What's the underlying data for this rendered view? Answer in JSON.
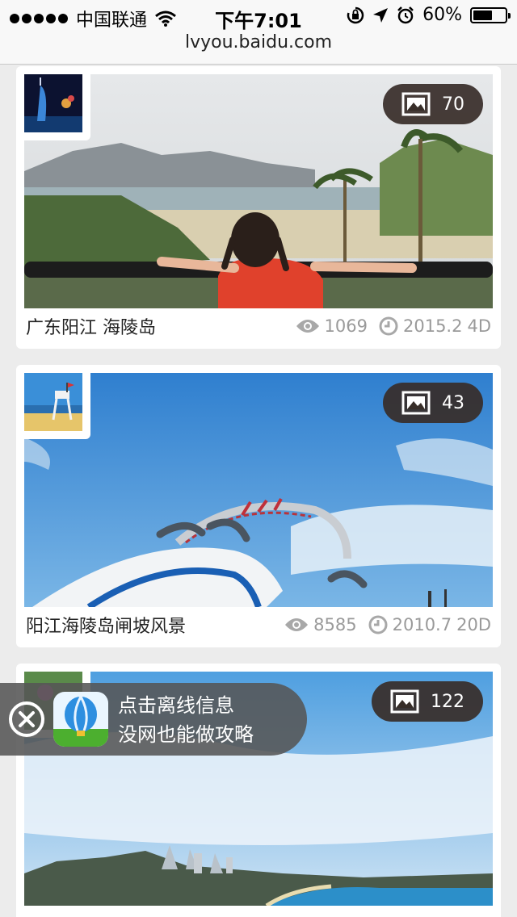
{
  "status_bar": {
    "carrier": "中国联通",
    "time": "下午7:01",
    "battery_percent": "60%",
    "battery_level": 0.6,
    "icons": [
      "signal-dots-icon",
      "wifi-icon",
      "rotation-lock-icon",
      "location-arrow-icon",
      "alarm-icon",
      "battery-icon"
    ]
  },
  "browser": {
    "url": "lvyou.baidu.com"
  },
  "cards": [
    {
      "photo_count": "70",
      "title": "广东阳江 海陵岛",
      "views": "1069",
      "date": "2015.2",
      "duration": "4D"
    },
    {
      "photo_count": "43",
      "title": "阳江海陵岛闸坡风景",
      "views": "8585",
      "date": "2010.7",
      "duration": "20D"
    },
    {
      "photo_count": "122",
      "title": "",
      "views": "",
      "date": "",
      "duration": ""
    }
  ],
  "promo": {
    "line1": "点击离线信息",
    "line2": "没网也能做攻略"
  },
  "icons": {
    "badge": "picture-icon",
    "views": "eye-icon",
    "date": "clock-icon",
    "close": "close-icon",
    "app": "hot-air-balloon-icon"
  },
  "colors": {
    "badge_bg": "#372d28",
    "meta_text": "#9a9a9a",
    "page_bg": "#ececec"
  }
}
